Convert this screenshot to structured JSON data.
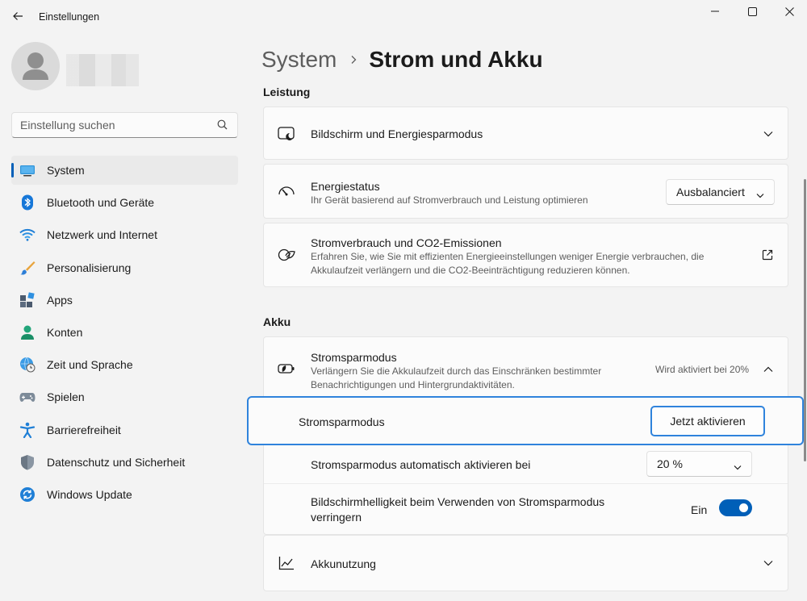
{
  "window": {
    "title": "Einstellungen",
    "controls": [
      "minimize",
      "maximize",
      "close"
    ]
  },
  "search": {
    "placeholder": "Einstellung suchen"
  },
  "sidebar": {
    "items": [
      {
        "label": "System",
        "icon": "system-icon",
        "active": true
      },
      {
        "label": "Bluetooth und Geräte",
        "icon": "bluetooth-icon"
      },
      {
        "label": "Netzwerk und Internet",
        "icon": "wifi-icon"
      },
      {
        "label": "Personalisierung",
        "icon": "brush-icon"
      },
      {
        "label": "Apps",
        "icon": "apps-icon"
      },
      {
        "label": "Konten",
        "icon": "account-icon"
      },
      {
        "label": "Zeit und Sprache",
        "icon": "globe-clock-icon"
      },
      {
        "label": "Spielen",
        "icon": "gamepad-icon"
      },
      {
        "label": "Barrierefreiheit",
        "icon": "accessibility-icon"
      },
      {
        "label": "Datenschutz und Sicherheit",
        "icon": "shield-icon"
      },
      {
        "label": "Windows Update",
        "icon": "update-icon"
      }
    ]
  },
  "breadcrumb": {
    "parent": "System",
    "current": "Strom und Akku"
  },
  "sections": {
    "performance": "Leistung",
    "battery": "Akku"
  },
  "cards": {
    "screen": {
      "title": "Bildschirm und Energiesparmodus"
    },
    "power_mode": {
      "title": "Energiestatus",
      "desc": "Ihr Gerät basierend auf Stromverbrauch und Leistung optimieren",
      "value": "Ausbalanciert"
    },
    "co2": {
      "title": "Stromverbrauch und CO2-Emissionen",
      "desc_line1": "Erfahren Sie, wie Sie mit effizienten Energieeinstellungen weniger Energie verbrauchen, die",
      "desc_line2": "Akkulaufzeit verlängern und die CO2-Beeinträchtigung reduzieren können."
    },
    "saver": {
      "title": "Stromsparmodus",
      "desc_line1": "Verlängern Sie die Akkulaufzeit durch das Einschränken bestimmter",
      "desc_line2": "Benachrichtigungen und Hintergrundaktivitäten.",
      "status": "Wird aktiviert bei 20%"
    },
    "saver_now": {
      "label": "Stromsparmodus",
      "button": "Jetzt aktivieren"
    },
    "saver_auto": {
      "label": "Stromsparmodus automatisch aktivieren bei",
      "value": "20 %"
    },
    "saver_brightness": {
      "label_line1": "Bildschirmhelligkeit beim Verwenden von Stromsparmodus",
      "label_line2": "verringern",
      "state": "Ein",
      "on": true
    },
    "usage": {
      "title": "Akkunutzung"
    }
  },
  "colors": {
    "accent": "#005fb8",
    "highlight": "#2f83dc"
  }
}
